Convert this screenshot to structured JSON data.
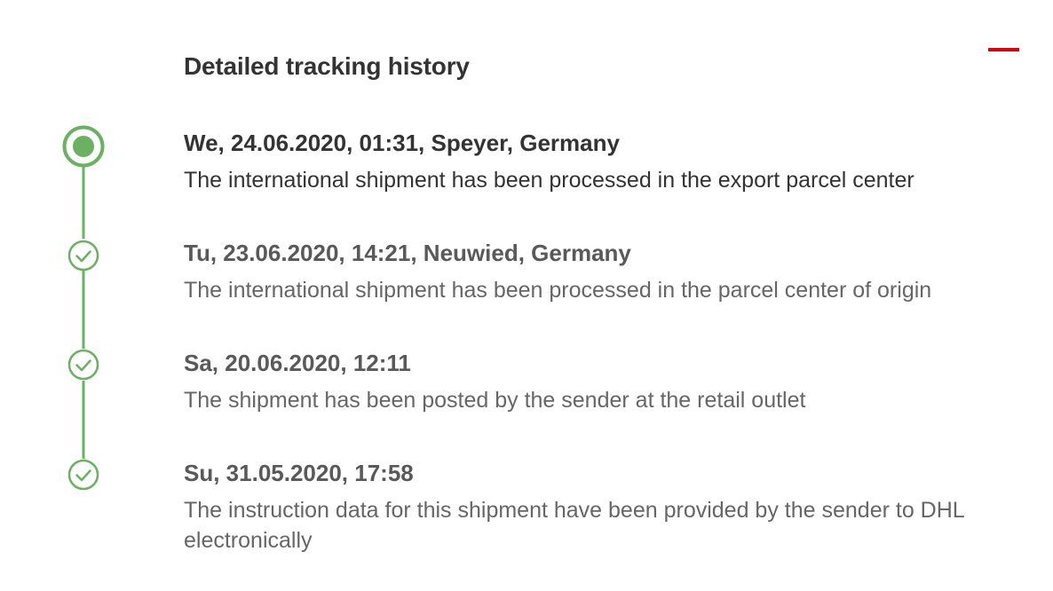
{
  "header": {
    "title": "Detailed tracking history"
  },
  "colors": {
    "accent_red": "#d40511",
    "timeline_green": "#6ab161",
    "text_dark": "#333333",
    "text_muted": "#666666"
  },
  "icons": {
    "collapse": "minus-icon",
    "current_status": "current-status-dot-icon",
    "completed_status": "checkmark-circle-icon"
  },
  "events": [
    {
      "date": "We, 24.06.2020, 01:31, Speyer, Germany",
      "description": "The international shipment has been processed in the export parcel center",
      "current": true
    },
    {
      "date": "Tu, 23.06.2020, 14:21, Neuwied, Germany",
      "description": "The international shipment has been processed in the parcel center of origin",
      "current": false
    },
    {
      "date": "Sa, 20.06.2020, 12:11",
      "description": "The shipment has been posted by the sender at the retail outlet",
      "current": false
    },
    {
      "date": "Su, 31.05.2020, 17:58",
      "description": "The instruction data for this shipment have been provided by the sender to DHL electronically",
      "current": false
    }
  ]
}
